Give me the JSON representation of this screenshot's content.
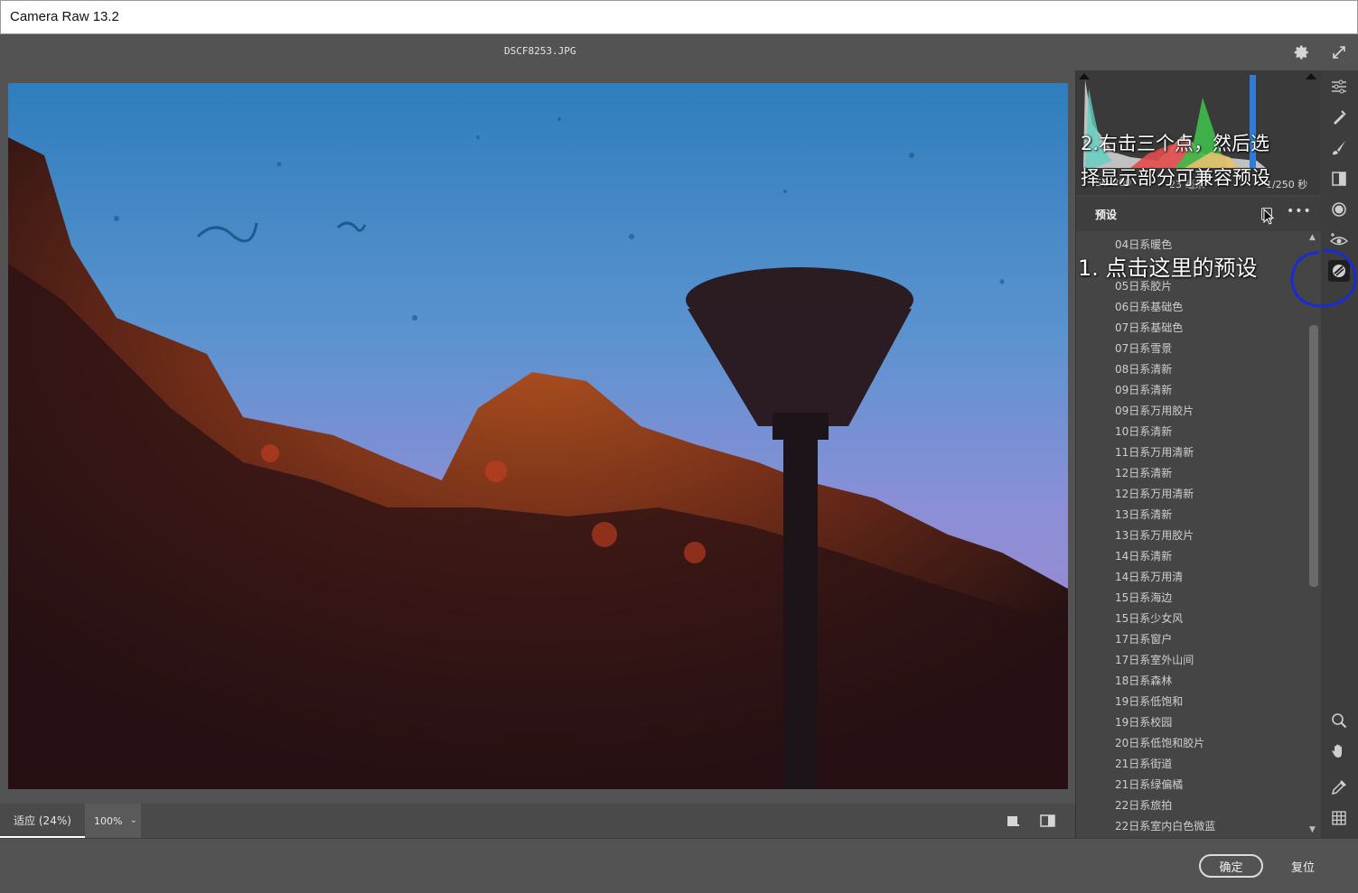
{
  "window": {
    "title": "Camera Raw 13.2"
  },
  "topbar": {
    "filename": "DSCF8253.JPG",
    "settings_icon": "gear-icon",
    "fullscreen_icon": "fullscreen-icon"
  },
  "status": {
    "zoom_fit": "适应 (24%)",
    "zoom_percent": "100%"
  },
  "histogram": {
    "iso": "ISO 200",
    "focal": "23 毫米",
    "shutter": "1/250 秒"
  },
  "presets": {
    "title": "预设",
    "items": [
      "04日系暖色",
      "05日系胶片",
      "06日系基础色",
      "07日系基础色",
      "07日系雪景",
      "08日系清新",
      "09日系清新",
      "09日系万用胶片",
      "10日系清新",
      "11日系万用清新",
      "12日系清新",
      "12日系万用清新",
      "13日系清新",
      "13日系万用胶片",
      "14日系清新",
      "14日系万用清",
      "15日系海边",
      "15日系少女风",
      "17日系窗户",
      "17日系室外山间",
      "18日系森林",
      "19日系低饱和",
      "19日系校园",
      "20日系低饱和胶片",
      "21日系街道",
      "21日系绿偏橘",
      "22日系旅拍",
      "22日系室内白色微蓝"
    ]
  },
  "buttons": {
    "ok": "确定",
    "reset": "复位"
  },
  "annotations": {
    "step1": "1. 点击这里的预设",
    "step2_line1": "2.右击三个点，然后选",
    "step2_line2": "择显示部分可兼容预设"
  },
  "colors": {
    "panel_bg": "#454545",
    "canvas_bg": "#535353",
    "annotation_circle": "#1a2bd6"
  }
}
